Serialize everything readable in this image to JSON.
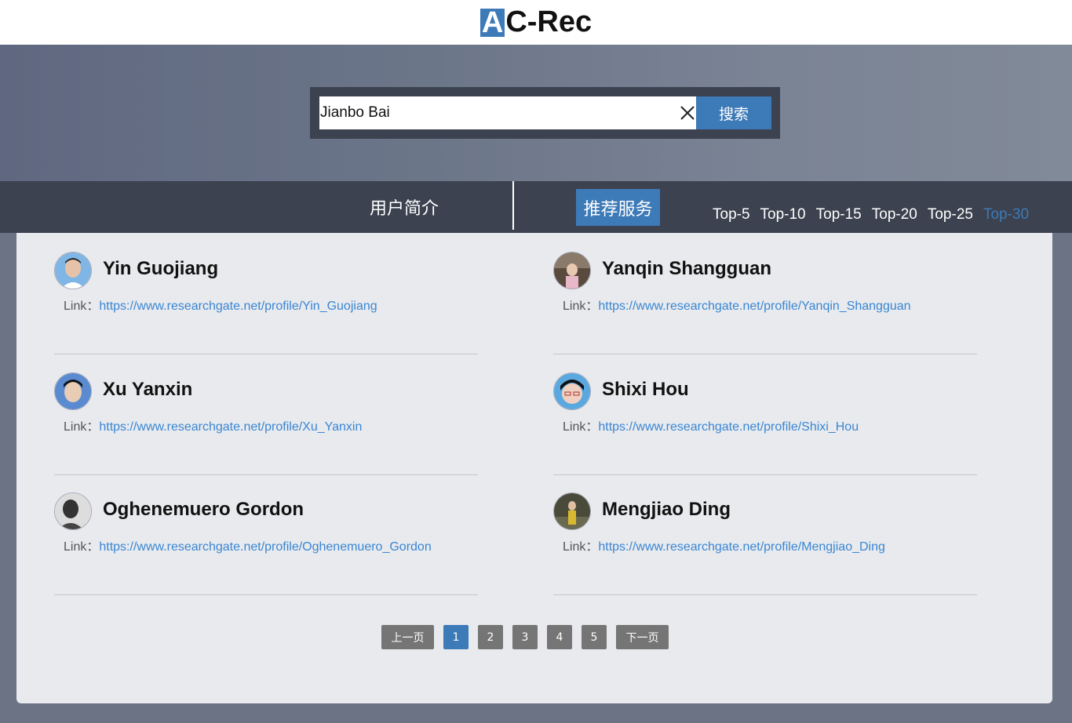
{
  "header": {
    "logo_first": "A",
    "logo_rest": "C-Rec"
  },
  "search": {
    "value": "Jianbo Bai",
    "button_label": "搜索"
  },
  "nav": {
    "profile_label": "用户简介",
    "recommend_label": "推荐服务",
    "topn": [
      "Top-5",
      "Top-10",
      "Top-15",
      "Top-20",
      "Top-25",
      "Top-30"
    ],
    "topn_active": "Top-30"
  },
  "results": [
    {
      "name": "Yin Guojiang",
      "link_label": "Link：",
      "url": "https://www.researchgate.net/profile/Yin_Guojiang"
    },
    {
      "name": "Yanqin Shangguan",
      "link_label": "Link：",
      "url": "https://www.researchgate.net/profile/Yanqin_Shangguan"
    },
    {
      "name": "Xu Yanxin",
      "link_label": "Link：",
      "url": "https://www.researchgate.net/profile/Xu_Yanxin"
    },
    {
      "name": "Shixi Hou",
      "link_label": "Link：",
      "url": "https://www.researchgate.net/profile/Shixi_Hou"
    },
    {
      "name": "Oghenemuero Gordon",
      "link_label": "Link：",
      "url": "https://www.researchgate.net/profile/Oghenemuero_Gordon"
    },
    {
      "name": "Mengjiao Ding",
      "link_label": "Link：",
      "url": "https://www.researchgate.net/profile/Mengjiao_Ding"
    }
  ],
  "pagination": {
    "prev_label": "上一页",
    "pages": [
      "1",
      "2",
      "3",
      "4",
      "5"
    ],
    "current": "1",
    "next_label": "下一页"
  },
  "colors": {
    "accent": "#3d7ab8",
    "nav_bg": "#3c424f",
    "link": "#3a86d4"
  }
}
